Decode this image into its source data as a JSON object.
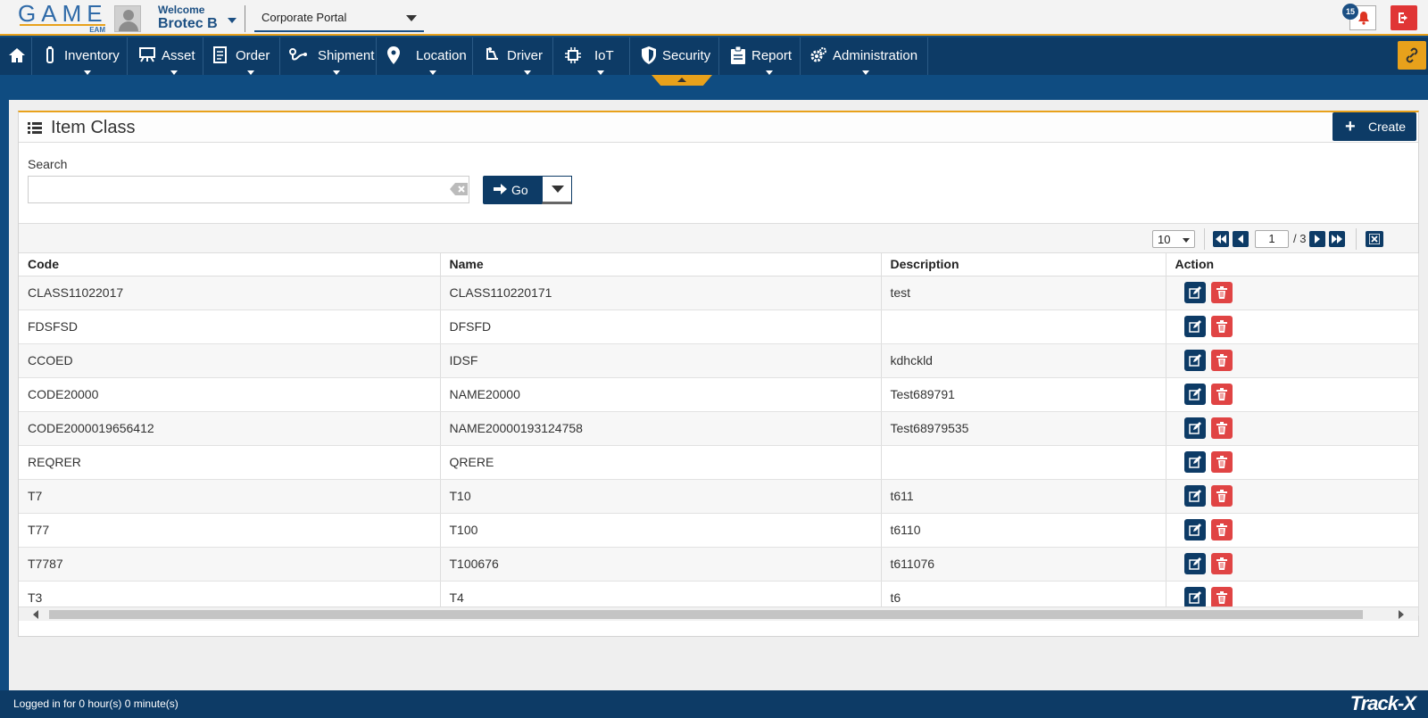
{
  "header": {
    "logo_text": "GAME",
    "logo_sub": "EAM",
    "welcome_label": "Welcome",
    "username": "Brotec B",
    "portal_selected": "Corporate Portal",
    "notification_count": "15"
  },
  "nav": {
    "items": [
      {
        "label": "Inventory",
        "icon": "inventory-icon"
      },
      {
        "label": "Asset",
        "icon": "asset-icon"
      },
      {
        "label": "Order",
        "icon": "order-icon"
      },
      {
        "label": "Shipment",
        "icon": "shipment-icon"
      },
      {
        "label": "Location",
        "icon": "location-pin-icon"
      },
      {
        "label": "Driver",
        "icon": "driver-icon"
      },
      {
        "label": "IoT",
        "icon": "chip-icon"
      },
      {
        "label": "Security",
        "icon": "shield-icon"
      },
      {
        "label": "Report",
        "icon": "clipboard-icon"
      },
      {
        "label": "Administration",
        "icon": "gears-icon"
      }
    ]
  },
  "page": {
    "title": "Item Class",
    "create_label": "Create",
    "search_label": "Search",
    "search_value": "",
    "go_label": "Go"
  },
  "pager": {
    "page_size": "10",
    "current_page": "1",
    "total_pages": "/ 3"
  },
  "table": {
    "columns": [
      "Code",
      "Name",
      "Description",
      "Action"
    ],
    "rows": [
      {
        "code": "CLASS11022017",
        "name": "CLASS110220171",
        "description": "test"
      },
      {
        "code": "FDSFSD",
        "name": "DFSFD",
        "description": ""
      },
      {
        "code": "CCOED",
        "name": "IDSF",
        "description": "kdhckld"
      },
      {
        "code": "CODE20000",
        "name": "NAME20000",
        "description": "Test689791"
      },
      {
        "code": "CODE2000019656412",
        "name": "NAME20000193124758",
        "description": "Test68979535"
      },
      {
        "code": "REQRER",
        "name": "QRERE",
        "description": ""
      },
      {
        "code": "T7",
        "name": "T10",
        "description": "t611"
      },
      {
        "code": "T77",
        "name": "T100",
        "description": "t6110"
      },
      {
        "code": "T7787",
        "name": "T100676",
        "description": "t611076"
      },
      {
        "code": "T3",
        "name": "T4",
        "description": "t6"
      }
    ]
  },
  "footer": {
    "status": "Logged in for 0 hour(s) 0 minute(s)",
    "brand": "Track-X"
  },
  "colors": {
    "primary": "#0d3b66",
    "accent": "#e8a11b",
    "danger": "#e04444"
  }
}
